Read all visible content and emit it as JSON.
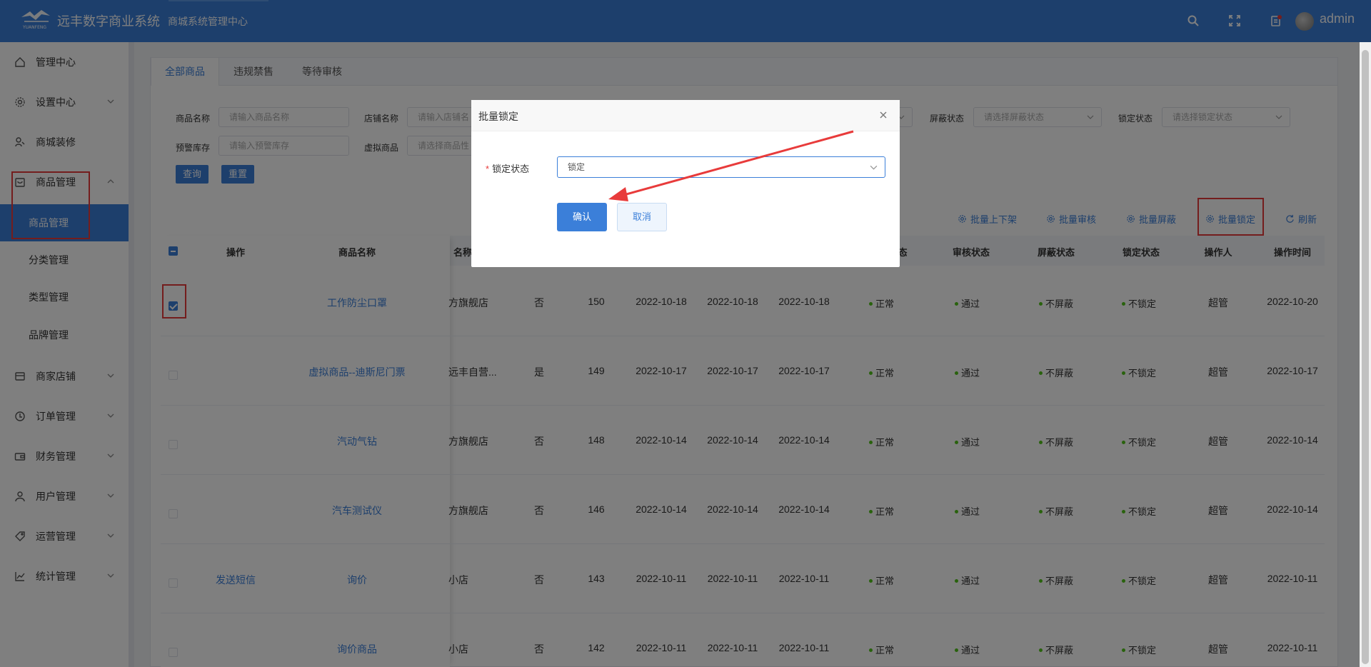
{
  "header": {
    "brand": "远丰数字商业系统",
    "logo_text": "YUANFENG",
    "subtitle": "商城系统管理中心",
    "username": "admin"
  },
  "sidebar": {
    "items": [
      {
        "label": "管理中心",
        "icon": "home-icon"
      },
      {
        "label": "设置中心",
        "icon": "gear-icon"
      },
      {
        "label": "商城装修",
        "icon": "decorate-icon"
      },
      {
        "label": "商品管理",
        "icon": "goods-icon"
      },
      {
        "label": "商家店铺",
        "icon": "shop-icon"
      },
      {
        "label": "订单管理",
        "icon": "order-icon"
      },
      {
        "label": "财务管理",
        "icon": "wallet-icon"
      },
      {
        "label": "用户管理",
        "icon": "user-icon"
      },
      {
        "label": "运营管理",
        "icon": "tag-icon"
      },
      {
        "label": "统计管理",
        "icon": "chart-icon"
      }
    ],
    "sub_items": [
      "商品管理",
      "分类管理",
      "类型管理",
      "品牌管理"
    ]
  },
  "tabs": [
    "全部商品",
    "违规禁售",
    "等待审核"
  ],
  "filters": {
    "goods_name_label": "商品名称",
    "goods_name_placeholder": "请输入商品名称",
    "store_name_label": "店铺名称",
    "store_name_placeholder": "请输入店铺名",
    "shield_label": "屏蔽状态",
    "shield_placeholder": "请选择屏蔽状态",
    "lock_label": "锁定状态",
    "lock_placeholder": "请选择锁定状态",
    "stock_label": "预警库存",
    "stock_placeholder": "请输入预警库存",
    "virtual_label": "虚拟商品",
    "virtual_placeholder": "请选择商品性",
    "query_btn": "查询",
    "reset_btn": "重置"
  },
  "toolbar": [
    "批量上下架",
    "批量审核",
    "批量屏蔽",
    "批量锁定",
    "刷新"
  ],
  "table": {
    "headers": {
      "op": "操作",
      "name": "商品名称",
      "store": "名称",
      "status_tail": "态",
      "audit": "审核状态",
      "shield": "屏蔽状态",
      "lock": "锁定状态",
      "operator": "操作人",
      "time": "操作时间"
    },
    "rows": [
      {
        "op": "",
        "name": "工作防尘口罩",
        "store": "方旗舰店",
        "virtual": "否",
        "id": "150",
        "d1": "2022-10-18",
        "d2": "2022-10-18",
        "d3": "2022-10-18",
        "state": "正常",
        "audit": "通过",
        "shield": "不屏蔽",
        "lock": "不锁定",
        "operator": "超管",
        "time": "2022-10-20"
      },
      {
        "op": "",
        "name": "虚拟商品--迪斯尼门票",
        "store": "远丰自营...",
        "virtual": "是",
        "id": "149",
        "d1": "2022-10-17",
        "d2": "2022-10-17",
        "d3": "2022-10-17",
        "state": "正常",
        "audit": "通过",
        "shield": "不屏蔽",
        "lock": "不锁定",
        "operator": "超管",
        "time": "2022-10-17"
      },
      {
        "op": "",
        "name": "汽动气钻",
        "store": "方旗舰店",
        "virtual": "否",
        "id": "148",
        "d1": "2022-10-14",
        "d2": "2022-10-14",
        "d3": "2022-10-14",
        "state": "正常",
        "audit": "通过",
        "shield": "不屏蔽",
        "lock": "不锁定",
        "operator": "超管",
        "time": "2022-10-14"
      },
      {
        "op": "",
        "name": "汽车测试仪",
        "store": "方旗舰店",
        "virtual": "否",
        "id": "146",
        "d1": "2022-10-14",
        "d2": "2022-10-14",
        "d3": "2022-10-14",
        "state": "正常",
        "audit": "通过",
        "shield": "不屏蔽",
        "lock": "不锁定",
        "operator": "超管",
        "time": "2022-10-14"
      },
      {
        "op": "发送短信",
        "name": "询价",
        "store": "小店",
        "virtual": "否",
        "id": "143",
        "d1": "2022-10-11",
        "d2": "2022-10-11",
        "d3": "2022-10-11",
        "state": "正常",
        "audit": "通过",
        "shield": "不屏蔽",
        "lock": "不锁定",
        "operator": "超管",
        "time": "2022-10-11"
      },
      {
        "op": "",
        "name": "询价商品",
        "store": "小店",
        "virtual": "否",
        "id": "142",
        "d1": "2022-10-11",
        "d2": "2022-10-11",
        "d3": "2022-10-11",
        "state": "正常",
        "audit": "通过",
        "shield": "不屏蔽",
        "lock": "不锁定",
        "operator": "超管",
        "time": "2022-10-11"
      }
    ]
  },
  "dialog": {
    "title": "批量锁定",
    "required_mark": "*",
    "field_label": "锁定状态",
    "field_value": "锁定",
    "confirm": "确认",
    "cancel": "取消"
  },
  "colors": {
    "primary": "#3b7fd9",
    "highlight": "#e83b3b",
    "status_dot": "#52c41a"
  }
}
